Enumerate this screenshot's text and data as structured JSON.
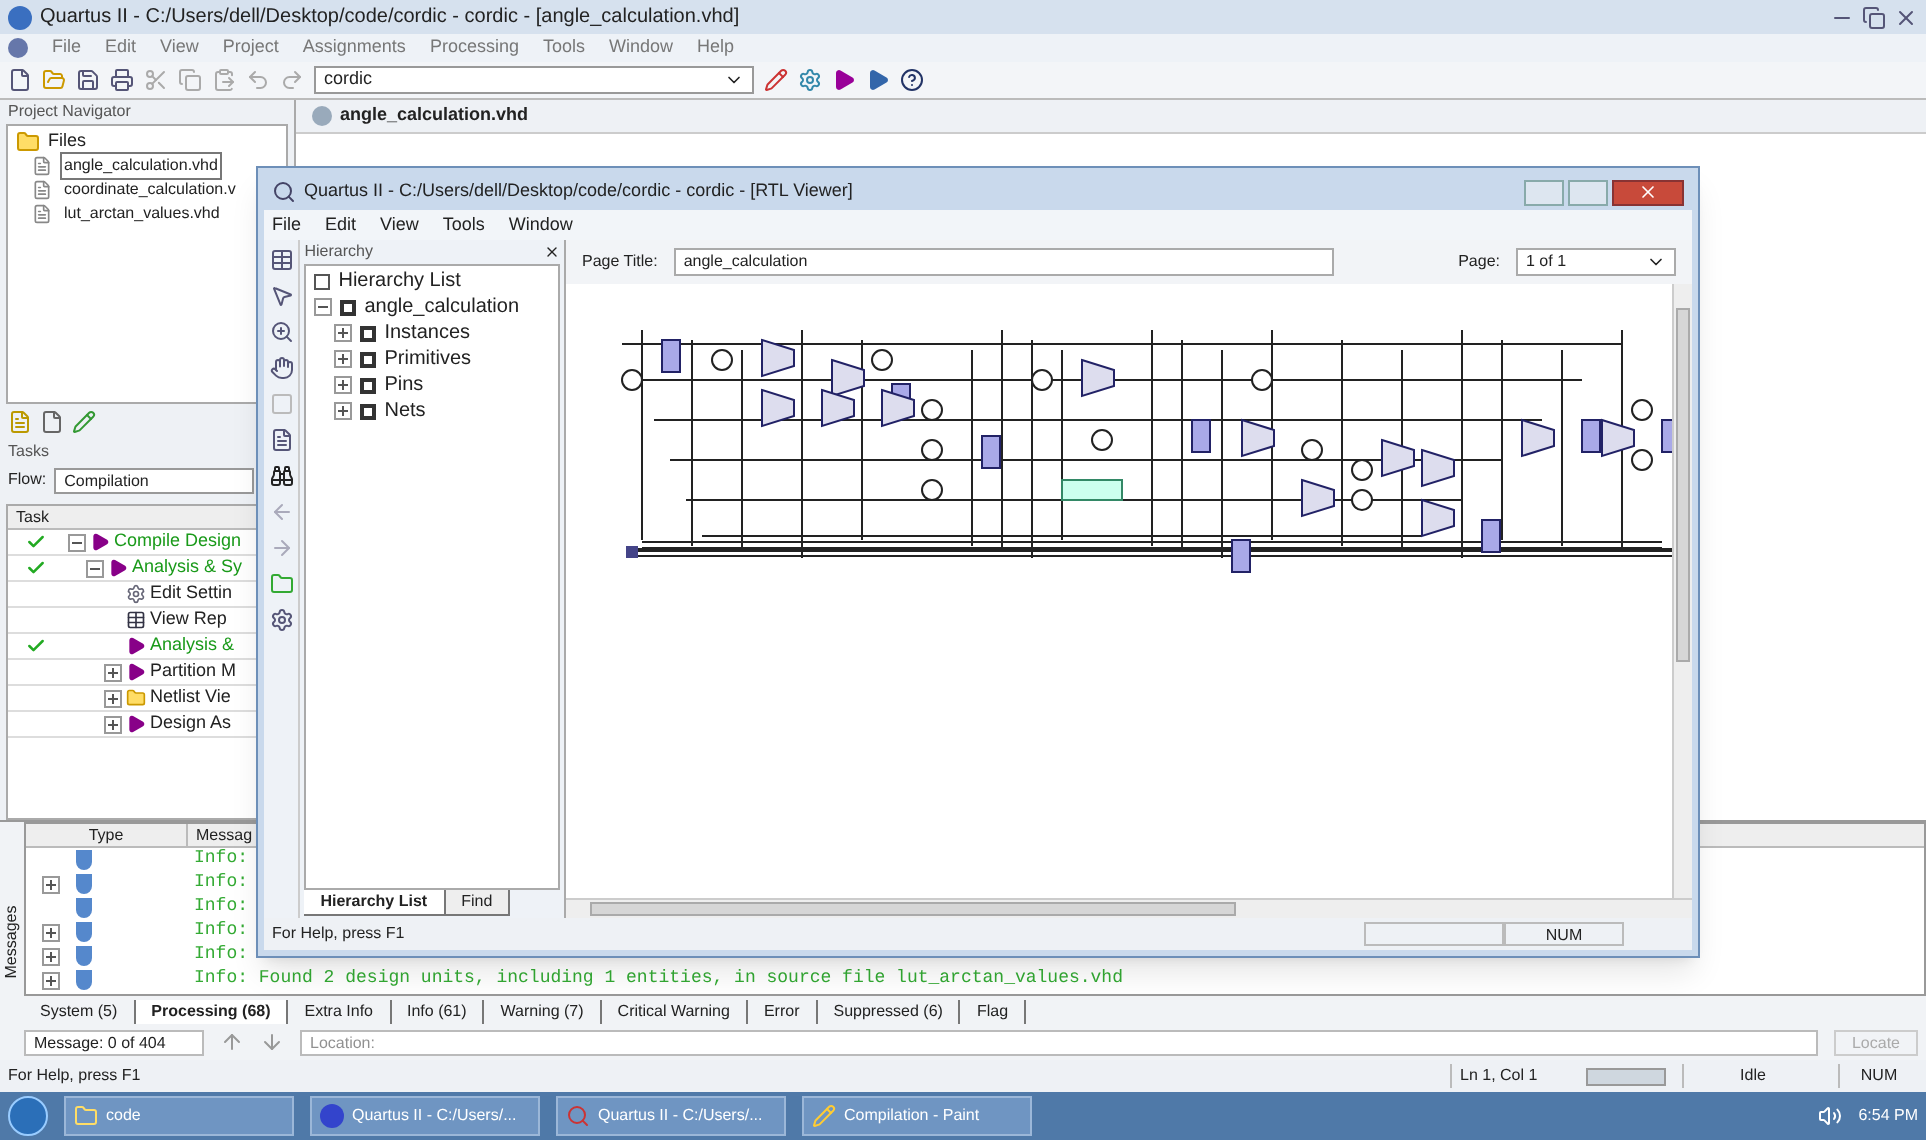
{
  "window": {
    "title": "Quartus II - C:/Users/dell/Desktop/code/cordic - cordic - [angle_calculation.vhd]"
  },
  "menu": [
    "File",
    "Edit",
    "View",
    "Project",
    "Assignments",
    "Processing",
    "Tools",
    "Window",
    "Help"
  ],
  "toolbar": {
    "project_combo": "cordic"
  },
  "project_navigator": {
    "title": "Project Navigator",
    "files": {
      "label": "Files",
      "children": [
        {
          "label": "angle_calculation.vhd",
          "selected": true
        },
        {
          "label": "coordinate_calculation.v",
          "selected": false
        },
        {
          "label": "lut_arctan_values.vhd",
          "selected": false
        }
      ]
    }
  },
  "tasks": {
    "title": "Tasks",
    "flow_label": "Flow:",
    "flow": "Compilation",
    "column": "Task",
    "items": [
      {
        "label": "Compile Design",
        "done": true,
        "expanded": true,
        "kind": "run",
        "children": [
          {
            "label": "Analysis & Sy",
            "done": true,
            "expanded": true,
            "kind": "run",
            "children": [
              {
                "label": "Edit Settin",
                "done": false,
                "kind": "settings"
              },
              {
                "label": "View Rep",
                "done": false,
                "kind": "report"
              },
              {
                "label": "Analysis &",
                "done": true,
                "kind": "run"
              },
              {
                "label": "Partition M",
                "done": false,
                "expanded": false,
                "kind": "run"
              },
              {
                "label": "Netlist Vie",
                "done": false,
                "expanded": false,
                "kind": "folder"
              },
              {
                "label": "Design As",
                "done": false,
                "expanded": false,
                "kind": "run"
              }
            ]
          }
        ]
      }
    ]
  },
  "editor": {
    "tab": "angle_calculation.vhd"
  },
  "rtl_viewer": {
    "title": "Quartus II - C:/Users/dell/Desktop/code/cordic - cordic - [RTL Viewer]",
    "menu": [
      "File",
      "Edit",
      "View",
      "Tools",
      "Window"
    ],
    "hierarchy": {
      "title": "Hierarchy",
      "root": "Hierarchy List",
      "items": [
        {
          "label": "angle_calculation",
          "expanded": true,
          "children": [
            {
              "label": "Instances",
              "expanded": false
            },
            {
              "label": "Primitives",
              "expanded": false
            },
            {
              "label": "Pins",
              "expanded": false
            },
            {
              "label": "Nets",
              "expanded": false
            }
          ]
        }
      ]
    },
    "tabs": [
      {
        "label": "Hierarchy List",
        "selected": true
      },
      {
        "label": "Find",
        "selected": false
      }
    ],
    "page_title_label": "Page Title:",
    "page_title": "angle_calculation",
    "page_label": "Page:",
    "page": "1 of 1",
    "status": "For Help, press F1",
    "num": "NUM"
  },
  "messages": {
    "side_label": "Messages",
    "columns": [
      "Type",
      "Messag"
    ],
    "rows": [
      {
        "text": "Info:"
      },
      {
        "text": "Info:",
        "expanded": false
      },
      {
        "text": "Info:"
      },
      {
        "text": "Info:",
        "expanded": false
      },
      {
        "text": "Info:",
        "expanded": false
      },
      {
        "text": "Info: Found 2 design units, including 1 entities, in source file lut_arctan_values.vhd",
        "expanded": false
      }
    ],
    "tabs": [
      {
        "label": "System (5)",
        "selected": false
      },
      {
        "label": "Processing (68)",
        "selected": true
      },
      {
        "label": "Extra Info",
        "selected": false
      },
      {
        "label": "Info (61)",
        "selected": false
      },
      {
        "label": "Warning (7)",
        "selected": false
      },
      {
        "label": "Critical Warning",
        "selected": false
      },
      {
        "label": "Error",
        "selected": false
      },
      {
        "label": "Suppressed (6)",
        "selected": false
      },
      {
        "label": "Flag",
        "selected": false
      }
    ],
    "counter": "Message: 0 of 404",
    "location_placeholder": "Location:",
    "locate": "Locate"
  },
  "status_bar": {
    "help": "For Help, press F1",
    "position": "Ln 1, Col 1",
    "state": "Idle",
    "num": "NUM"
  },
  "taskbar": {
    "items": [
      {
        "label": "code",
        "kind": "folder"
      },
      {
        "label": "Quartus II - C:/Users/...",
        "kind": "quartus"
      },
      {
        "label": "Quartus II - C:/Users/...",
        "kind": "rtl"
      },
      {
        "label": "Compilation - Paint",
        "kind": "paint"
      }
    ],
    "time": "6:54 PM"
  }
}
